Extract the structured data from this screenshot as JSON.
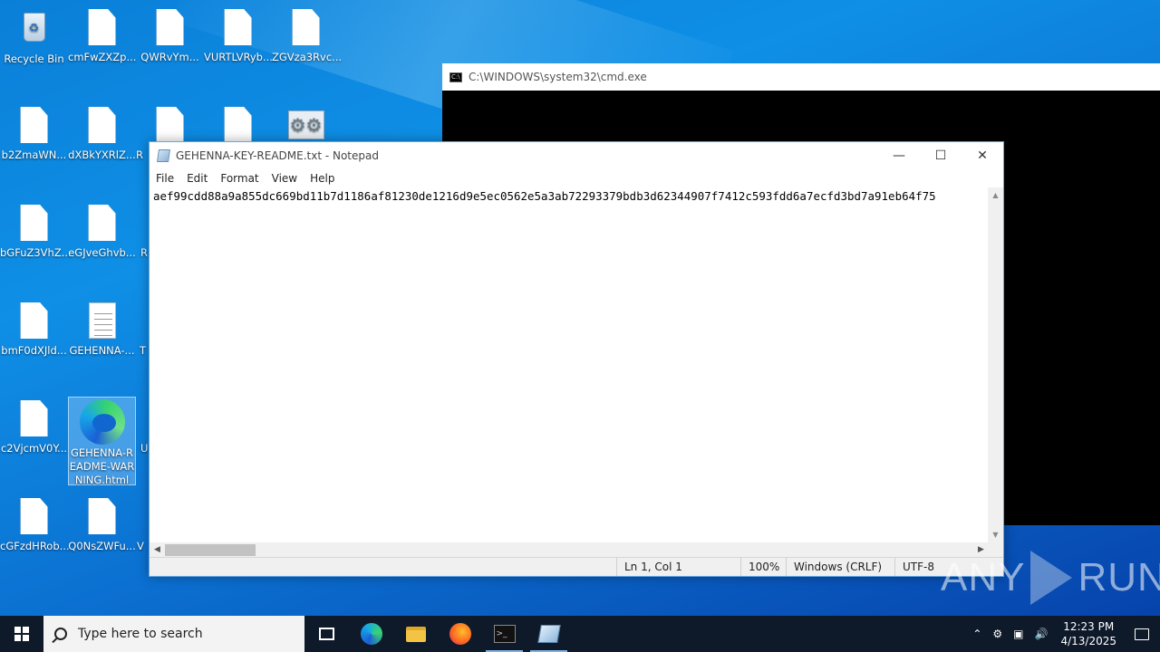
{
  "desktop": {
    "icons": [
      {
        "label": "Recycle Bin"
      },
      {
        "label": "cmFwZXZp..."
      },
      {
        "label": "QWRvYm..."
      },
      {
        "label": "VURTLVRyb..."
      },
      {
        "label": "ZGVza3Rvc..."
      },
      {
        "label": "b2ZmaWN..."
      },
      {
        "label": "dXBkYXRlZ..."
      },
      {
        "label": "R"
      },
      {
        "label": "bGFuZ3VhZ..."
      },
      {
        "label": "eGJveGhvb..."
      },
      {
        "label": "R"
      },
      {
        "label": "bmF0dXJld..."
      },
      {
        "label": "GEHENNA-..."
      },
      {
        "label": "T"
      },
      {
        "label": "c2VjcmV0Y..."
      },
      {
        "label": "GEHENNA-README-WARNING.html"
      },
      {
        "label": "U"
      },
      {
        "label": "cGFzdHRob..."
      },
      {
        "label": "Q0NsZWFu..."
      },
      {
        "label": "V"
      }
    ]
  },
  "cmd": {
    "title": "C:\\WINDOWS\\system32\\cmd.exe"
  },
  "notepad": {
    "title": "GEHENNA-KEY-README.txt - Notepad",
    "menu": [
      "File",
      "Edit",
      "Format",
      "View",
      "Help"
    ],
    "content": "aef99cdd88a9a855dc669bd11b7d1186af81230de1216d9e5ec0562e5a3ab72293379bdb3d62344907f7412c593fdd6a7ecfd3bd7a91eb64f75",
    "status": {
      "position": "Ln 1, Col 1",
      "zoom": "100%",
      "line_ending": "Windows (CRLF)",
      "encoding": "UTF-8"
    }
  },
  "taskbar": {
    "search_placeholder": "Type here to search",
    "time": "12:23 PM",
    "date": "4/13/2025"
  },
  "watermark": {
    "left": "ANY",
    "right": "RUN"
  }
}
